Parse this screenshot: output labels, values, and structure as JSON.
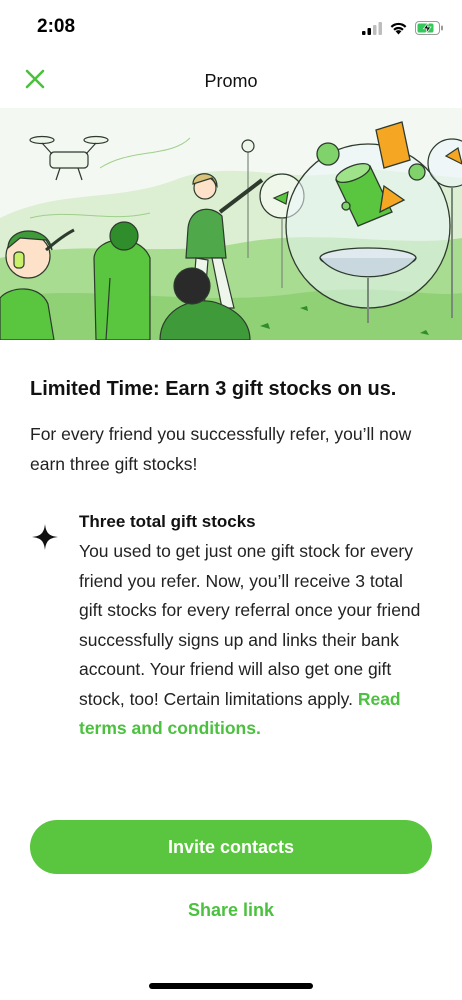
{
  "status_bar": {
    "time": "2:08",
    "icons": [
      "cellular-signal-icon",
      "wifi-icon",
      "battery-charging-icon"
    ]
  },
  "nav": {
    "title": "Promo",
    "close_icon": "close-icon"
  },
  "hero": {
    "description_icon": "promo-illustration"
  },
  "content": {
    "headline": "Limited Time: Earn 3 gift stocks on us.",
    "intro": "For every friend you successfully refer, you’ll now earn three gift stocks!",
    "feature": {
      "icon": "sparkle-icon",
      "title": "Three total gift stocks",
      "body": "You used to get just one gift stock for every friend you refer. Now, you’ll receive 3 total gift stocks for every referral once your friend successfully signs up and links their bank account. Your friend will also get one gift stock, too! Certain limitations apply. ",
      "link_label": "Read terms and conditions."
    }
  },
  "actions": {
    "invite_label": "Invite contacts",
    "share_label": "Share link"
  },
  "colors": {
    "accent": "#5ac53e",
    "link": "#4cc13f",
    "text": "#111111"
  }
}
